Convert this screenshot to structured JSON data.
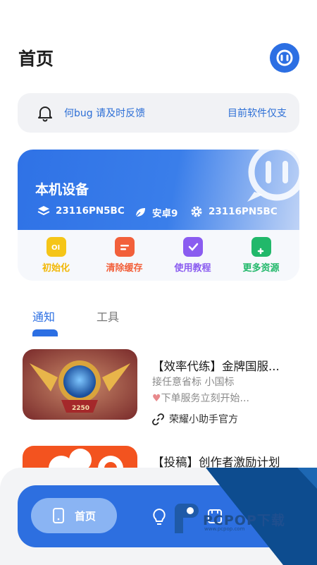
{
  "header": {
    "title": "首页",
    "logo_icon": "link-circle-icon"
  },
  "notice": {
    "message": "何bug 请及时反馈",
    "version_text": "目前软件仅支"
  },
  "device": {
    "title": "本机设备",
    "specs": [
      {
        "icon": "layers-icon",
        "text": "23116PN5BC"
      },
      {
        "icon": "leaf-icon",
        "text": "安卓9"
      },
      {
        "icon": "gear-icon",
        "text": "23116PN5BC"
      }
    ],
    "actions": [
      {
        "label": "初始化",
        "color": "#f2b705",
        "icon": "init-icon"
      },
      {
        "label": "清除缓存",
        "color": "#f2603b",
        "icon": "clear-cache-icon"
      },
      {
        "label": "使用教程",
        "color": "#8a5cf0",
        "icon": "tutorial-icon"
      },
      {
        "label": "更多资源",
        "color": "#21b86a",
        "icon": "more-resources-icon"
      }
    ]
  },
  "tabs": [
    {
      "label": "通知",
      "active": true
    },
    {
      "label": "工具",
      "active": false
    }
  ],
  "articles": [
    {
      "title": "【效率代练】金牌国服...",
      "subtitle": "接任意省标 小国标",
      "description": "下单服务立刻开始...",
      "author": "荣耀小助手官方",
      "thumb_label": "2250"
    },
    {
      "title": "【投稿】创作者激励计划"
    }
  ],
  "bottom_nav": {
    "home_label": "首页",
    "items": [
      "home-icon",
      "bulb-icon",
      "store-icon"
    ]
  },
  "watermark": {
    "text": "PCPOP下载",
    "sub": "www.pcpop.com"
  },
  "colors": {
    "accent": "#2c6fe3",
    "notice_text": "#2d6fd6"
  }
}
